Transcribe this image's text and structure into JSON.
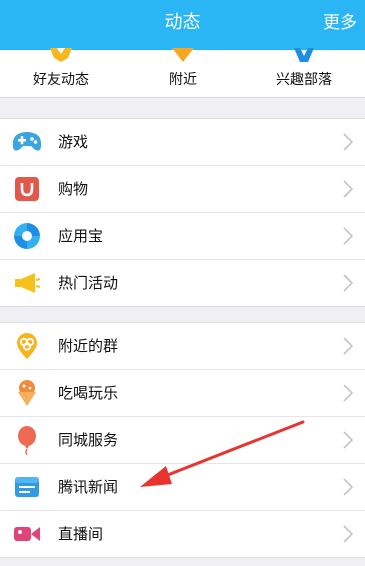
{
  "header": {
    "title": "动态",
    "more": "更多",
    "bg_color": "#2ab6f5"
  },
  "topnav": {
    "items": [
      {
        "label": "好友动态",
        "icon": "friend-feed-icon"
      },
      {
        "label": "附近",
        "icon": "nearby-icon"
      },
      {
        "label": "兴趣部落",
        "icon": "interest-tribe-icon"
      }
    ]
  },
  "groups": [
    {
      "items": [
        {
          "label": "游戏",
          "icon": "gamepad-icon",
          "color": "#3aa6e0"
        },
        {
          "label": "购物",
          "icon": "shopping-bag-icon",
          "color": "#e2594b"
        },
        {
          "label": "应用宝",
          "icon": "app-store-icon",
          "color": "#1f8fe3"
        },
        {
          "label": "热门活动",
          "icon": "megaphone-icon",
          "color": "#f4c21b"
        }
      ]
    },
    {
      "items": [
        {
          "label": "附近的群",
          "icon": "nearby-group-icon",
          "color": "#f4b521"
        },
        {
          "label": "吃喝玩乐",
          "icon": "ice-cream-icon",
          "color": "#f08a3c"
        },
        {
          "label": "同城服务",
          "icon": "balloon-icon",
          "color": "#ef6a55"
        },
        {
          "label": "腾讯新闻",
          "icon": "news-icon",
          "color": "#2e9be2"
        },
        {
          "label": "直播间",
          "icon": "video-camera-icon",
          "color": "#e0457a"
        }
      ]
    }
  ],
  "annotation": {
    "color": "#e8332f"
  }
}
